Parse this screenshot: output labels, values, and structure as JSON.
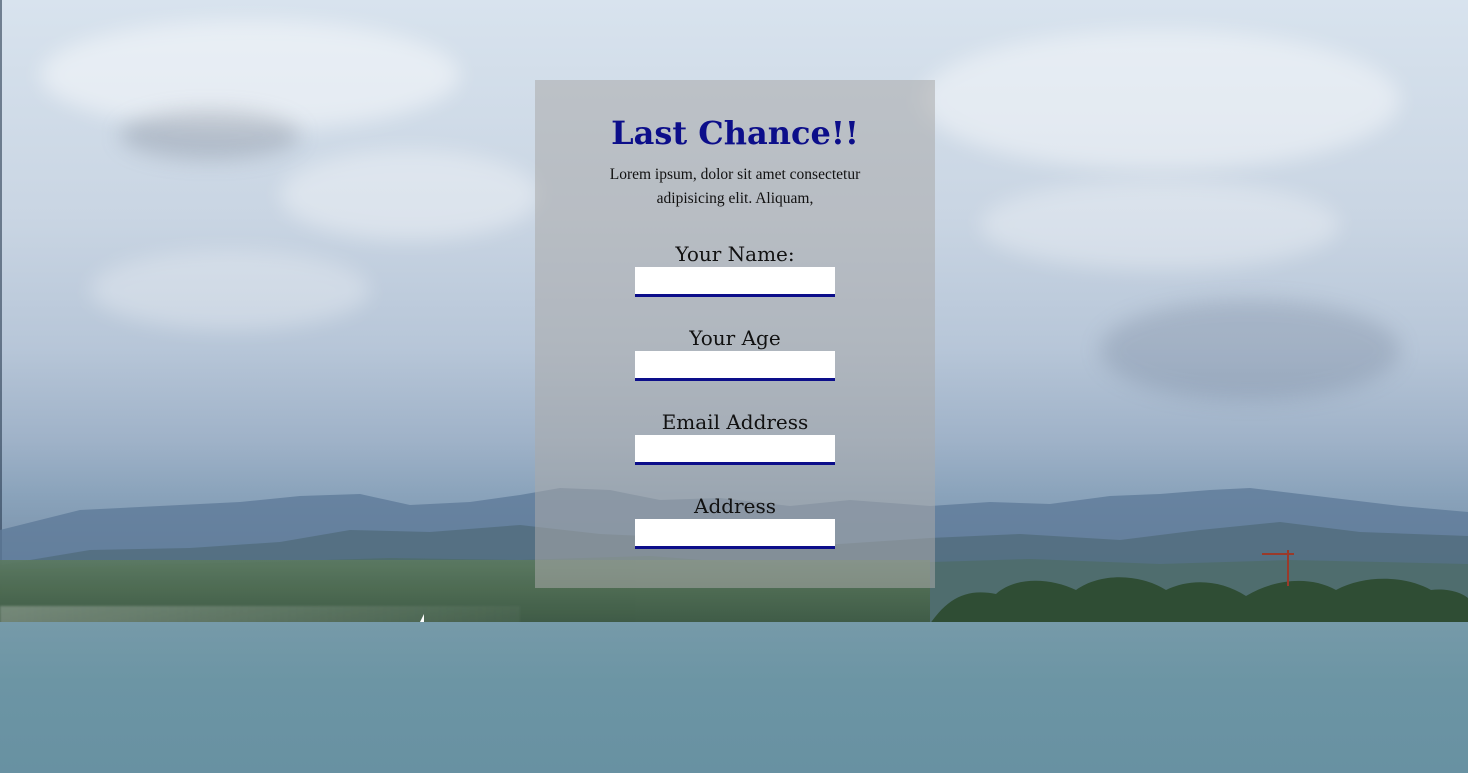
{
  "form": {
    "title": "Last Chance!!",
    "intro": "Lorem ipsum, dolor sit amet consectetur adipisicing elit. Aliquam,",
    "fields": [
      {
        "label": "Your Name:",
        "value": ""
      },
      {
        "label": "Your Age",
        "value": ""
      },
      {
        "label": "Email Address",
        "value": ""
      },
      {
        "label": "Address",
        "value": ""
      }
    ]
  },
  "colors": {
    "title": "#0c0e8a",
    "underline": "#0c0e8a",
    "panel": "rgba(170,170,170,0.55)"
  }
}
